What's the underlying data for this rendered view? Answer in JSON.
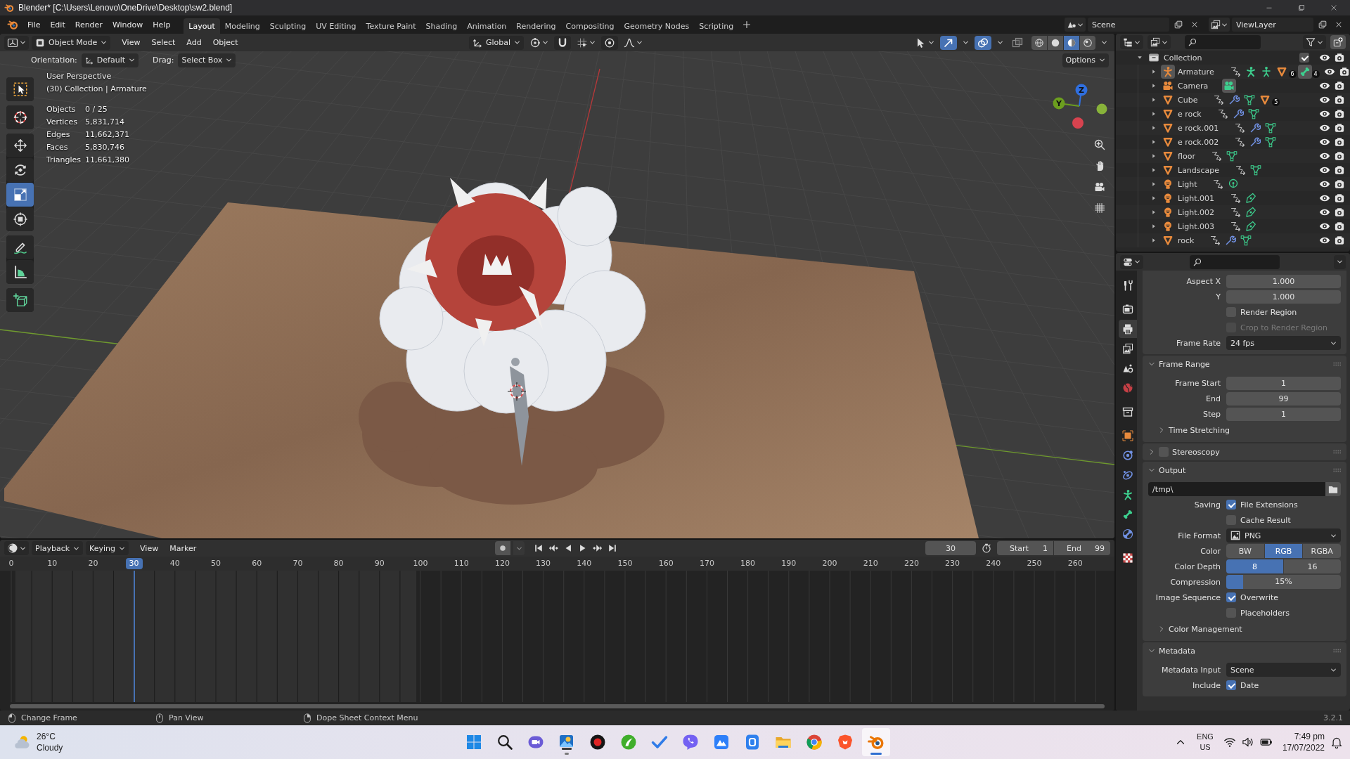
{
  "window": {
    "title": "Blender* [C:\\Users\\Lenovo\\OneDrive\\Desktop\\sw2.blend]"
  },
  "menu": [
    "File",
    "Edit",
    "Render",
    "Window",
    "Help"
  ],
  "workspaces": [
    {
      "label": "Layout",
      "selected": true
    },
    {
      "label": "Modeling",
      "selected": false
    },
    {
      "label": "Sculpting",
      "selected": false
    },
    {
      "label": "UV Editing",
      "selected": false
    },
    {
      "label": "Texture Paint",
      "selected": false
    },
    {
      "label": "Shading",
      "selected": false
    },
    {
      "label": "Animation",
      "selected": false
    },
    {
      "label": "Rendering",
      "selected": false
    },
    {
      "label": "Compositing",
      "selected": false
    },
    {
      "label": "Geometry Nodes",
      "selected": false
    },
    {
      "label": "Scripting",
      "selected": false
    }
  ],
  "scene": "Scene",
  "view_layer": "ViewLayer",
  "viewport": {
    "mode": "Object Mode",
    "menu": [
      "View",
      "Select",
      "Add",
      "Object"
    ],
    "transform_orientation": "Global",
    "toggles": [
      {
        "kind": "gizmo",
        "on": true
      },
      {
        "kind": "overlay",
        "on": true
      },
      {
        "kind": "xray",
        "on": false
      }
    ],
    "shading": [
      {
        "kind": "wireframe",
        "selected": false
      },
      {
        "kind": "solid",
        "selected": false
      },
      {
        "kind": "material",
        "selected": true
      },
      {
        "kind": "rendered",
        "selected": false
      }
    ],
    "tool_settings": {
      "orientation_label": "Orientation:",
      "orientation": "Default",
      "drag_label": "Drag:",
      "drag": "Select Box",
      "options": "Options"
    },
    "tool_groups": [
      {
        "tools": [
          {
            "kind": "select_box",
            "selected": false
          }
        ]
      },
      {
        "tools": [
          {
            "kind": "cursor",
            "selected": false
          }
        ]
      },
      {
        "tools": [
          {
            "kind": "move",
            "selected": false
          },
          {
            "kind": "rotate",
            "selected": false
          },
          {
            "kind": "scale",
            "selected": true
          },
          {
            "kind": "transform",
            "selected": false
          }
        ]
      },
      {
        "tools": [
          {
            "kind": "annotate",
            "selected": false
          },
          {
            "kind": "measure",
            "selected": false
          }
        ]
      },
      {
        "tools": [
          {
            "kind": "add_cube",
            "selected": false
          }
        ]
      }
    ],
    "view_name": "User Perspective",
    "context": "(30) Collection | Armature",
    "stats": [
      {
        "label": "Objects",
        "value": "0 / 25"
      },
      {
        "label": "Vertices",
        "value": "5,831,714"
      },
      {
        "label": "Edges",
        "value": "11,662,371"
      },
      {
        "label": "Faces",
        "value": "5,830,746"
      },
      {
        "label": "Triangles",
        "value": "11,661,380"
      }
    ],
    "axes": [
      {
        "kind": "z",
        "label": "Z"
      },
      {
        "kind": "y",
        "label": "Y"
      },
      {
        "kind": "x"
      },
      {
        "kind": "y_neg"
      }
    ],
    "nav": [
      {
        "kind": "zoom"
      },
      {
        "kind": "pan"
      },
      {
        "kind": "camera"
      },
      {
        "kind": "ortho"
      }
    ]
  },
  "outliner": {
    "collection": {
      "name": "Collection",
      "expanded": true,
      "checked": true,
      "visible": true,
      "renderable": true,
      "children": [
        {
          "name": "Armature",
          "kind": "armature",
          "active": true,
          "expanded": false,
          "visible": true,
          "renderable": true,
          "data": [
            {
              "kind": "link",
              "active": false
            },
            {
              "kind": "pose",
              "active": false
            },
            {
              "kind": "armature_data",
              "active": false
            },
            {
              "kind": "mesh_object",
              "active": false,
              "count": "6"
            },
            {
              "kind": "bone",
              "active": true,
              "count": "4"
            }
          ]
        },
        {
          "name": "Camera",
          "kind": "camera",
          "active": false,
          "expanded": false,
          "visible": true,
          "renderable": true,
          "data": [
            {
              "kind": "camera_data",
              "active": true
            }
          ]
        },
        {
          "name": "Cube",
          "kind": "mesh",
          "active": false,
          "expanded": false,
          "visible": true,
          "renderable": true,
          "data": [
            {
              "kind": "link",
              "active": false
            },
            {
              "kind": "modifier",
              "active": false
            },
            {
              "kind": "mesh_data",
              "active": false
            },
            {
              "kind": "mesh_object",
              "active": false,
              "count": "5"
            }
          ]
        },
        {
          "name": "e rock",
          "kind": "mesh",
          "active": false,
          "expanded": false,
          "visible": true,
          "renderable": true,
          "data": [
            {
              "kind": "link",
              "active": false
            },
            {
              "kind": "modifier",
              "active": false
            },
            {
              "kind": "mesh_data",
              "active": false
            }
          ]
        },
        {
          "name": "e rock.001",
          "kind": "mesh",
          "active": false,
          "expanded": false,
          "visible": true,
          "renderable": true,
          "data": [
            {
              "kind": "link",
              "active": false
            },
            {
              "kind": "modifier",
              "active": false
            },
            {
              "kind": "mesh_data",
              "active": false
            }
          ]
        },
        {
          "name": "e rock.002",
          "kind": "mesh",
          "active": false,
          "expanded": false,
          "visible": true,
          "renderable": true,
          "data": [
            {
              "kind": "link",
              "active": false
            },
            {
              "kind": "modifier",
              "active": false
            },
            {
              "kind": "mesh_data",
              "active": false
            }
          ]
        },
        {
          "name": "floor",
          "kind": "mesh",
          "active": false,
          "expanded": false,
          "visible": true,
          "renderable": true,
          "data": [
            {
              "kind": "link",
              "active": false
            },
            {
              "kind": "mesh_data",
              "active": false
            }
          ]
        },
        {
          "name": "Landscape",
          "kind": "mesh",
          "active": false,
          "expanded": false,
          "visible": true,
          "renderable": true,
          "data": [
            {
              "kind": "link",
              "active": false
            },
            {
              "kind": "mesh_data",
              "active": false
            }
          ]
        },
        {
          "name": "Light",
          "kind": "light",
          "active": false,
          "expanded": false,
          "visible": true,
          "renderable": true,
          "data": [
            {
              "kind": "link",
              "active": false
            },
            {
              "kind": "point_light",
              "active": false
            }
          ]
        },
        {
          "name": "Light.001",
          "kind": "light",
          "active": false,
          "expanded": false,
          "visible": true,
          "renderable": true,
          "data": [
            {
              "kind": "link",
              "active": false
            },
            {
              "kind": "spot_light",
              "active": false
            }
          ]
        },
        {
          "name": "Light.002",
          "kind": "light",
          "active": false,
          "expanded": false,
          "visible": true,
          "renderable": true,
          "data": [
            {
              "kind": "link",
              "active": false
            },
            {
              "kind": "spot_light",
              "active": false
            }
          ]
        },
        {
          "name": "Light.003",
          "kind": "light",
          "active": false,
          "expanded": false,
          "visible": true,
          "renderable": true,
          "data": [
            {
              "kind": "link",
              "active": false
            },
            {
              "kind": "spot_light",
              "active": false
            }
          ]
        },
        {
          "name": "rock",
          "kind": "mesh",
          "active": false,
          "expanded": false,
          "visible": true,
          "renderable": true,
          "data": [
            {
              "kind": "link",
              "active": false
            },
            {
              "kind": "modifier",
              "active": false
            },
            {
              "kind": "mesh_data",
              "active": false
            }
          ]
        }
      ]
    }
  },
  "properties": {
    "tab_groups": [
      {
        "tabs": [
          {
            "kind": "tool",
            "selected": false
          }
        ]
      },
      {
        "tabs": [
          {
            "kind": "render",
            "selected": false
          },
          {
            "kind": "output",
            "selected": true
          },
          {
            "kind": "view_layer",
            "selected": false
          },
          {
            "kind": "scene",
            "selected": false
          },
          {
            "kind": "world",
            "selected": false
          }
        ]
      },
      {
        "tabs": [
          {
            "kind": "collection",
            "selected": false
          }
        ]
      },
      {
        "tabs": [
          {
            "kind": "object",
            "selected": false
          },
          {
            "kind": "physics",
            "selected": false
          },
          {
            "kind": "constraints",
            "selected": false
          },
          {
            "kind": "armature",
            "selected": false
          },
          {
            "kind": "bone",
            "selected": false
          },
          {
            "kind": "bone_constraints",
            "selected": false
          }
        ]
      },
      {
        "tabs": [
          {
            "kind": "texture",
            "selected": false
          }
        ]
      }
    ],
    "panels": [
      {
        "kind": "continued",
        "rows": [
          {
            "kind": "number",
            "label": "Aspect X",
            "value": "1.000"
          },
          {
            "kind": "number",
            "label": "Y",
            "value": "1.000"
          },
          {
            "kind": "checkbox",
            "text": "Render Region",
            "checked": false,
            "disabled": false
          },
          {
            "kind": "checkbox",
            "text": "Crop to Render Region",
            "checked": false,
            "disabled": true
          },
          {
            "kind": "dropdown",
            "label": "Frame Rate",
            "value": "24 fps"
          }
        ]
      },
      {
        "kind": "plain",
        "title": "Frame Range",
        "expanded": true,
        "rows": [
          {
            "kind": "number",
            "label": "Frame Start",
            "value": "1"
          },
          {
            "kind": "number",
            "label": "End",
            "value": "99"
          },
          {
            "kind": "number",
            "label": "Step",
            "value": "1"
          },
          {
            "kind": "subpanel",
            "title": "Time Stretching",
            "expanded": false
          }
        ]
      },
      {
        "kind": "checkbox",
        "title": "Stereoscopy",
        "expanded": false,
        "checked": false
      },
      {
        "kind": "plain",
        "title": "Output",
        "expanded": true,
        "rows": [
          {
            "kind": "path",
            "value": "/tmp\\"
          },
          {
            "kind": "checkbox",
            "label": "Saving",
            "text": "File Extensions",
            "checked": true,
            "disabled": false
          },
          {
            "kind": "checkbox",
            "text": "Cache Result",
            "checked": false,
            "disabled": false
          },
          {
            "kind": "image_dropdown",
            "label": "File Format",
            "value": "PNG"
          },
          {
            "kind": "segmented",
            "label": "Color",
            "options": [
              {
                "label": "BW",
                "selected": false
              },
              {
                "label": "RGB",
                "selected": true
              },
              {
                "label": "RGBA",
                "selected": false
              }
            ]
          },
          {
            "kind": "segmented",
            "label": "Color Depth",
            "options": [
              {
                "label": "8",
                "selected": true
              },
              {
                "label": "16",
                "selected": false
              }
            ]
          },
          {
            "kind": "slider",
            "label": "Compression",
            "value": "15%",
            "level": 0.15
          },
          {
            "kind": "checkbox",
            "label": "Image Sequence",
            "text": "Overwrite",
            "checked": true,
            "disabled": false
          },
          {
            "kind": "checkbox",
            "text": "Placeholders",
            "checked": false,
            "disabled": false
          },
          {
            "kind": "subpanel",
            "title": "Color Management",
            "expanded": false
          }
        ]
      },
      {
        "kind": "plain",
        "title": "Metadata",
        "expanded": true,
        "rows": [
          {
            "kind": "dropdown",
            "label": "Metadata Input",
            "value": "Scene"
          },
          {
            "kind": "checkbox",
            "label": "Include",
            "text": "Date",
            "checked": true,
            "disabled": false
          }
        ]
      }
    ]
  },
  "timeline": {
    "menu": [
      {
        "kind": "dropdown",
        "label": "Playback"
      },
      {
        "kind": "dropdown",
        "label": "Keying"
      },
      {
        "kind": "menu",
        "label": "View"
      },
      {
        "kind": "menu",
        "label": "Marker"
      }
    ],
    "auto_keying": false,
    "current_frame": "30",
    "start_label": "Start",
    "start": "1",
    "end_label": "End",
    "end": "99",
    "ticks": [
      "0",
      "10",
      "20",
      "40",
      "50",
      "60",
      "70",
      "80",
      "90",
      "100",
      "110",
      "120",
      "130",
      "140",
      "150",
      "160",
      "170",
      "180",
      "190",
      "200",
      "210",
      "220",
      "230",
      "240",
      "250",
      "260"
    ],
    "playhead": "30"
  },
  "status": {
    "hints": [
      {
        "kind": "left",
        "label": "Change Frame"
      },
      {
        "kind": "middle",
        "label": "Pan View"
      },
      {
        "kind": "right",
        "label": "Dope Sheet Context Menu"
      }
    ],
    "version": "3.2.1"
  },
  "taskbar": {
    "temperature": "26°C",
    "condition": "Cloudy",
    "apps": [
      {
        "kind": "start",
        "running": false,
        "active": false
      },
      {
        "kind": "search",
        "running": false,
        "active": false
      },
      {
        "kind": "chat",
        "running": false,
        "active": false
      },
      {
        "kind": "photos",
        "running": true,
        "active": false
      },
      {
        "kind": "recorder",
        "running": false,
        "active": false
      },
      {
        "kind": "leaf",
        "running": false,
        "active": false
      },
      {
        "kind": "todo",
        "running": false,
        "active": false
      },
      {
        "kind": "messenger",
        "running": false,
        "active": false
      },
      {
        "kind": "mountain",
        "running": false,
        "active": false
      },
      {
        "kind": "tile",
        "running": false,
        "active": false
      },
      {
        "kind": "explorer",
        "running": false,
        "active": false
      },
      {
        "kind": "browser",
        "running": false,
        "active": false
      },
      {
        "kind": "shield",
        "running": false,
        "active": false
      },
      {
        "kind": "blender",
        "running": true,
        "active": true
      }
    ],
    "language": "ENG",
    "region": "US",
    "time": "7:49 pm",
    "date": "17/07/2022"
  }
}
